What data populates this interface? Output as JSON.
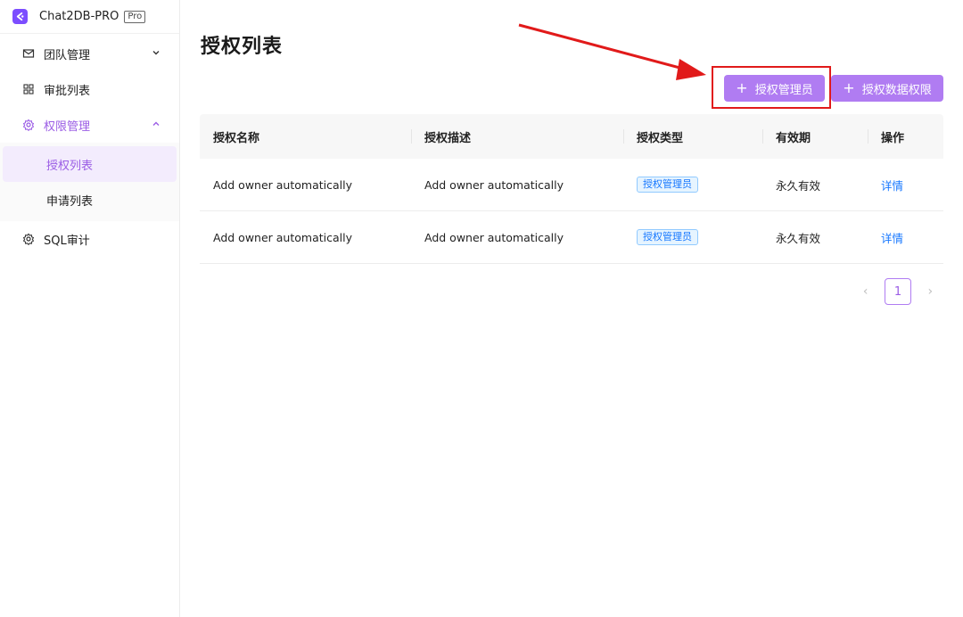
{
  "brand": {
    "name": "Chat2DB-PRO",
    "badge": "Pro"
  },
  "sidebar": {
    "items": [
      {
        "label": "团队管理",
        "icon": "mail-icon"
      },
      {
        "label": "审批列表",
        "icon": "grid-icon"
      },
      {
        "label": "权限管理",
        "icon": "gear-icon"
      },
      {
        "label": "SQL审计",
        "icon": "gear-icon"
      }
    ],
    "subitems": [
      {
        "label": "授权列表"
      },
      {
        "label": "申请列表"
      }
    ]
  },
  "main": {
    "title": "授权列表",
    "buttons": {
      "add_admin": "授权管理员",
      "add_data": "授权数据权限"
    },
    "table": {
      "headers": [
        "授权名称",
        "授权描述",
        "授权类型",
        "有效期",
        "操作"
      ],
      "rows": [
        {
          "name": "Add owner automatically",
          "desc": "Add owner automatically",
          "type": "授权管理员",
          "validity": "永久有效",
          "action": "详情"
        },
        {
          "name": "Add owner automatically",
          "desc": "Add owner automatically",
          "type": "授权管理员",
          "validity": "永久有效",
          "action": "详情"
        }
      ]
    },
    "pagination": {
      "current": "1",
      "prev": "‹",
      "next": "›"
    }
  },
  "colors": {
    "accent": "#b07cf2",
    "active_text": "#9b5de5",
    "link": "#1677ff",
    "annotation": "#e11a1a"
  }
}
